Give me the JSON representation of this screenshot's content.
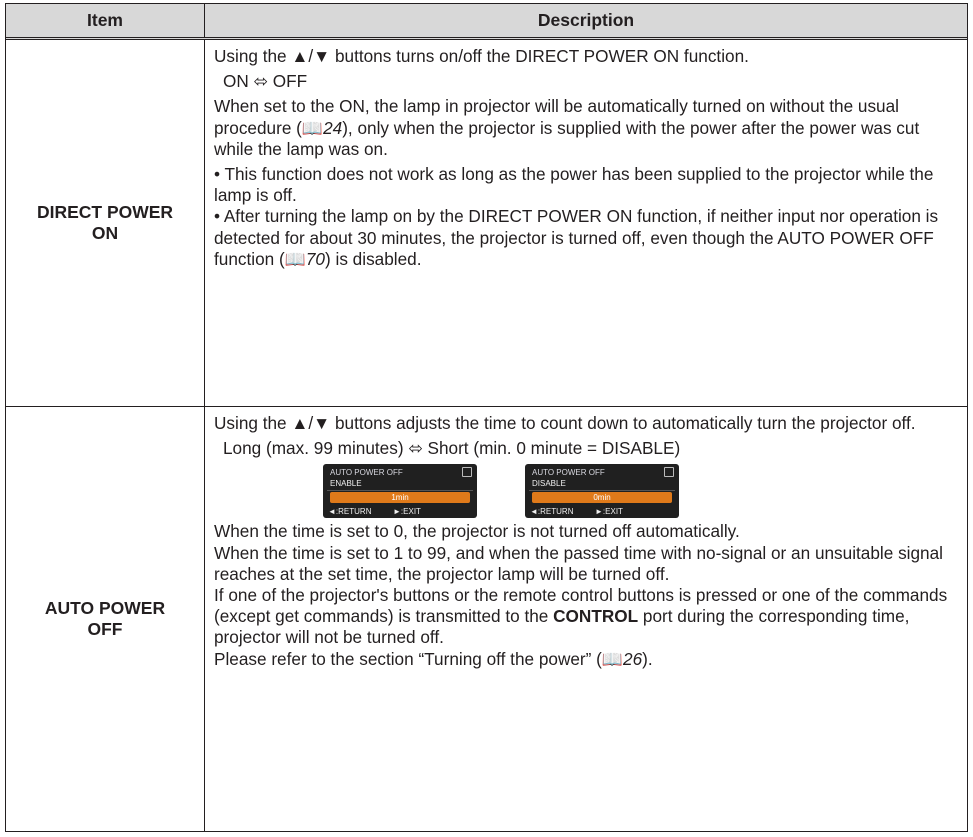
{
  "table": {
    "header": {
      "item": "Item",
      "description": "Description"
    },
    "direct_power_on": {
      "item_line1": "DIRECT POWER",
      "item_line2": "ON",
      "p1": "Using the ▲/▼ buttons turns on/off the DIRECT POWER ON function.",
      "p2": "ON ⬄ OFF",
      "p3a": "When set to the ON, the lamp in projector will be automatically turned on without the usual procedure (",
      "p3_ref": "24",
      "p3b": "), only when the projector is supplied with the power after the power was cut while the lamp was on.",
      "p4": "• This function does not work as long as the power has been supplied to the projector while the lamp is off.",
      "p5a": "• After turning the lamp on by the DIRECT POWER ON function, if neither input nor operation is detected for about 30 minutes, the projector is turned off, even though the AUTO POWER OFF function (",
      "p5_ref": "70",
      "p5b": ") is disabled."
    },
    "auto_power_off": {
      "item_line1": "AUTO POWER",
      "item_line2": "OFF",
      "p1": "Using the ▲/▼ buttons adjusts the time to count down to automatically turn the projector off.",
      "p2": "Long (max. 99 minutes) ⬄ Short (min. 0 minute = DISABLE)",
      "menus": [
        {
          "title": "AUTO POWER OFF",
          "state": "ENABLE",
          "value": "1min",
          "return": "RETURN",
          "exit": "EXIT"
        },
        {
          "title": "AUTO POWER OFF",
          "state": "DISABLE",
          "value": "0min",
          "return": "RETURN",
          "exit": "EXIT"
        }
      ],
      "p3": "When the time is set to 0, the projector is not turned off automatically.",
      "p4": "When the time is set to 1 to 99, and when the passed time with no-signal or an unsuitable signal reaches at the set time, the projector lamp will be turned off.",
      "p5a": "If one of the projector's buttons or the remote control buttons is pressed or one of the commands (except get commands) is transmitted to the ",
      "p5_bold": "CONTROL",
      "p5b": " port during the corresponding time, projector will not be turned off.",
      "p6a": "Please refer to the section “Turning off the power” (",
      "p6_ref": "26",
      "p6b": ")."
    }
  },
  "icons": {
    "book": "book-icon",
    "book_color": "#e0a400",
    "menu_bar_color": "#e07a1a"
  }
}
